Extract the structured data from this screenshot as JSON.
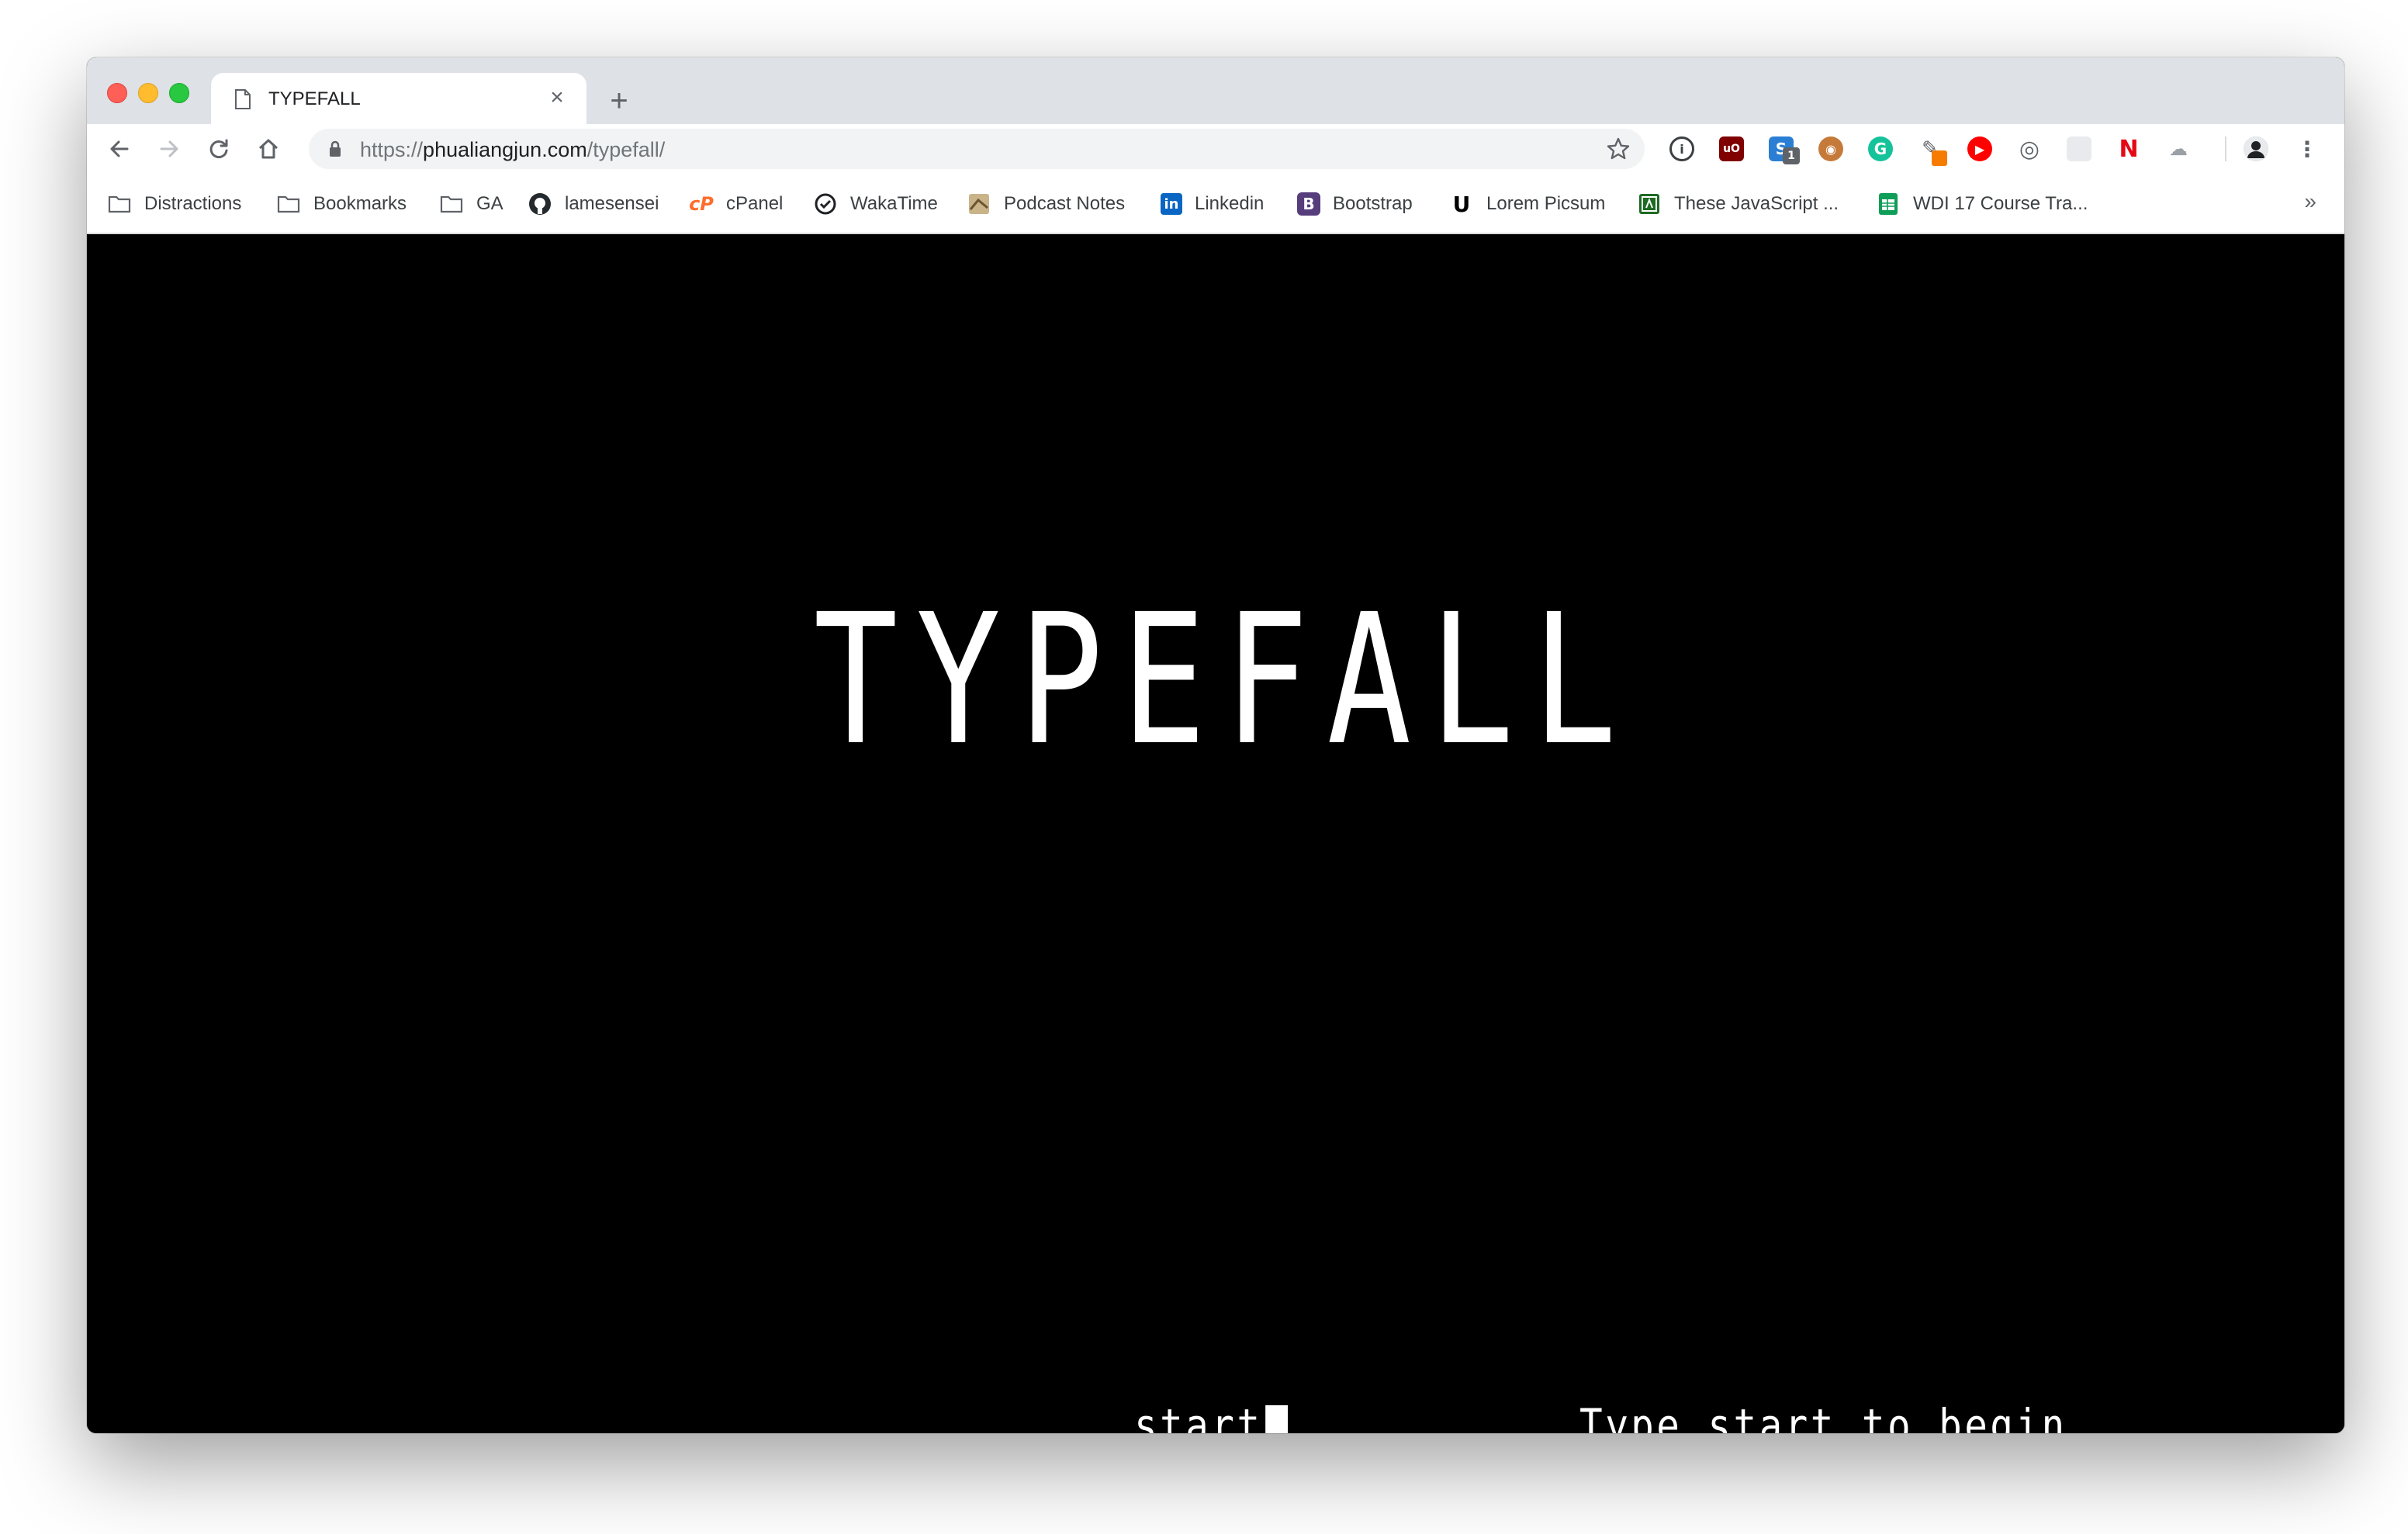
{
  "browser": {
    "tab": {
      "title": "TYPEFALL",
      "close_glyph": "×",
      "favicon": "document-icon"
    },
    "new_tab_glyph": "+",
    "url": {
      "scheme": "https://",
      "host": "phualiangjun.com",
      "path": "/typefall/"
    },
    "bookmarks": [
      {
        "label": "Distractions",
        "icon": "folder-icon"
      },
      {
        "label": "Bookmarks",
        "icon": "folder-icon"
      },
      {
        "label": "GA",
        "icon": "folder-icon"
      },
      {
        "label": "lamesensei",
        "icon": "github-icon"
      },
      {
        "label": "cPanel",
        "icon": "cpanel-icon"
      },
      {
        "label": "WakaTime",
        "icon": "wakatime-icon"
      },
      {
        "label": "Podcast Notes",
        "icon": "podcast-notes-icon"
      },
      {
        "label": "Linkedin",
        "icon": "linkedin-icon"
      },
      {
        "label": "Bootstrap",
        "icon": "bootstrap-icon"
      },
      {
        "label": "Lorem Picsum",
        "icon": "unsplash-icon"
      },
      {
        "label": "These JavaScript ...",
        "icon": "javascript-icon"
      },
      {
        "label": "WDI 17 Course Tra...",
        "icon": "sheets-icon"
      }
    ],
    "bookmarks_more_glyph": "»",
    "extension_badges": {
      "s_badge_count": "1"
    },
    "colors": {
      "tab_strip": "#dee1e6",
      "omnibox": "#f1f3f4"
    }
  },
  "game": {
    "title": "TYPEFALL",
    "typed_text": "start",
    "hint": "Type start to begin",
    "colors": {
      "background": "#000000",
      "text": "#ffffff"
    }
  }
}
